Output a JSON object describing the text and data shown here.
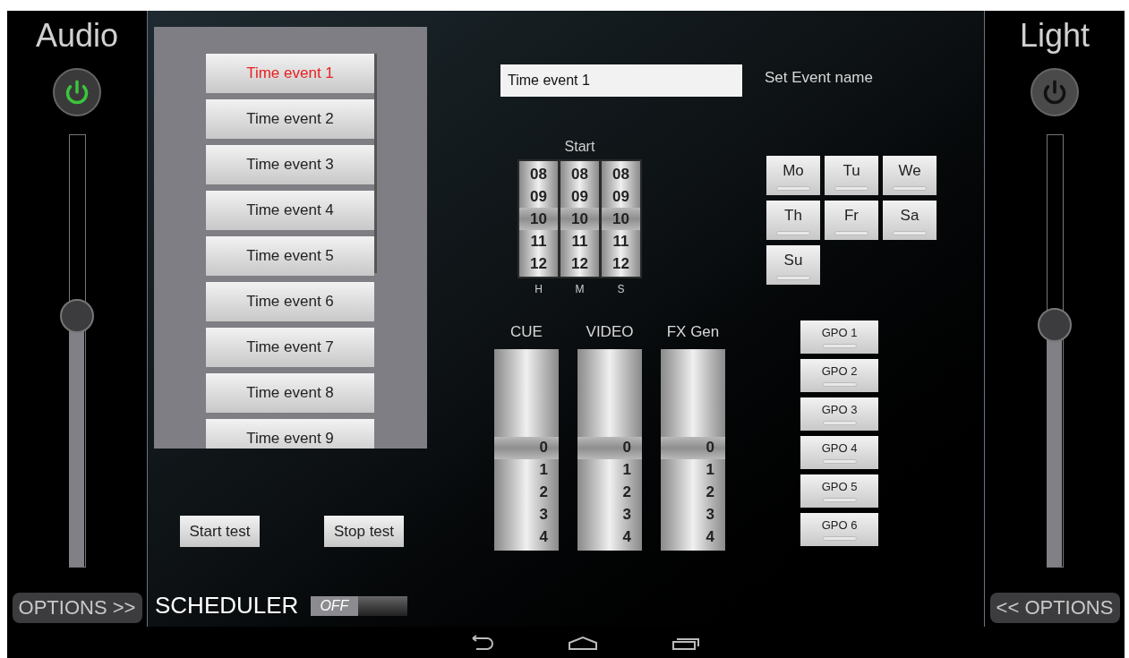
{
  "audio": {
    "title": "Audio",
    "power_on": true,
    "level": 0.58,
    "options": "OPTIONS >>"
  },
  "light": {
    "title": "Light",
    "power_on": false,
    "level": 0.56,
    "options": "<< OPTIONS"
  },
  "events": [
    {
      "label": "Time event 1",
      "selected": true
    },
    {
      "label": "Time event 2",
      "selected": false
    },
    {
      "label": "Time event 3",
      "selected": false
    },
    {
      "label": "Time event 4",
      "selected": false
    },
    {
      "label": "Time event 5",
      "selected": false
    },
    {
      "label": "Time event 6",
      "selected": false
    },
    {
      "label": "Time event 7",
      "selected": false
    },
    {
      "label": "Time event 8",
      "selected": false
    },
    {
      "label": "Time event 9",
      "selected": false
    }
  ],
  "test_buttons": [
    "Start test",
    "Stop test"
  ],
  "scheduler": {
    "label": "SCHEDULER",
    "on": false,
    "toggle_text": "OFF"
  },
  "event_name": {
    "value": "Time event 1",
    "label": "Set Event name"
  },
  "start": {
    "title": "Start",
    "columns": [
      {
        "label": "H",
        "values": [
          {
            "text": "08",
            "selected": false
          },
          {
            "text": "09",
            "selected": false
          },
          {
            "text": "10",
            "selected": true
          },
          {
            "text": "11",
            "selected": false
          },
          {
            "text": "12",
            "selected": false
          }
        ]
      },
      {
        "label": "M",
        "values": [
          {
            "text": "08",
            "selected": false
          },
          {
            "text": "09",
            "selected": false
          },
          {
            "text": "10",
            "selected": true
          },
          {
            "text": "11",
            "selected": false
          },
          {
            "text": "12",
            "selected": false
          }
        ]
      },
      {
        "label": "S",
        "values": [
          {
            "text": "08",
            "selected": false
          },
          {
            "text": "09",
            "selected": false
          },
          {
            "text": "10",
            "selected": true
          },
          {
            "text": "11",
            "selected": false
          },
          {
            "text": "12",
            "selected": false
          }
        ]
      }
    ]
  },
  "days": [
    "Mo",
    "Tu",
    "We",
    "Th",
    "Fr",
    "Sa",
    "Su"
  ],
  "channels": [
    {
      "label": "CUE",
      "values": [
        {
          "text": "0",
          "selected": true
        },
        {
          "text": "1",
          "selected": false
        },
        {
          "text": "2",
          "selected": false
        },
        {
          "text": "3",
          "selected": false
        },
        {
          "text": "4",
          "selected": false
        }
      ]
    },
    {
      "label": "VIDEO",
      "values": [
        {
          "text": "0",
          "selected": true
        },
        {
          "text": "1",
          "selected": false
        },
        {
          "text": "2",
          "selected": false
        },
        {
          "text": "3",
          "selected": false
        },
        {
          "text": "4",
          "selected": false
        }
      ]
    },
    {
      "label": "FX Gen",
      "values": [
        {
          "text": "0",
          "selected": true
        },
        {
          "text": "1",
          "selected": false
        },
        {
          "text": "2",
          "selected": false
        },
        {
          "text": "3",
          "selected": false
        },
        {
          "text": "4",
          "selected": false
        }
      ]
    }
  ],
  "gpo": [
    "GPO 1",
    "GPO 2",
    "GPO 3",
    "GPO 4",
    "GPO 5",
    "GPO 6"
  ]
}
